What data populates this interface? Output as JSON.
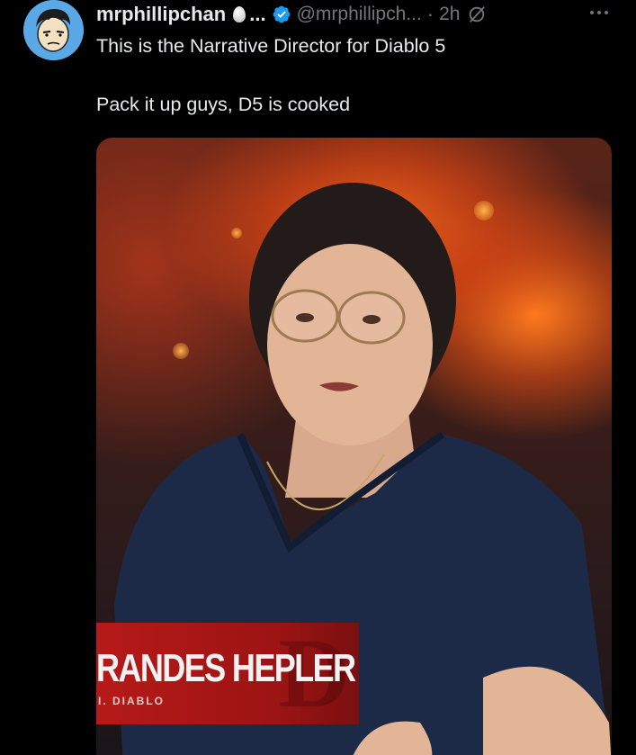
{
  "tweet": {
    "display_name": "mrphillipchan",
    "name_ellipsis": "...",
    "handle": "@mrphillipch...",
    "separator": "·",
    "time": "2h",
    "text_line1": "This is the Narrative Director for Diablo 5",
    "text_line2": "Pack it up guys, D5 is cooked",
    "icons": {
      "avatar": "cartoon-avatar",
      "badge": "egg-emoji",
      "verified": "verified-badge-icon",
      "grok": "grok-icon",
      "more": "more-options-icon"
    },
    "colors": {
      "verified": "#1d9bf0",
      "muted": "#71767b",
      "text": "#e7e9ea",
      "background": "#000000"
    }
  },
  "media": {
    "lower_third_name": "RANDES HEPLER",
    "lower_third_subtitle": "I. DIABLO",
    "lower_third_color": "#b51a18"
  }
}
